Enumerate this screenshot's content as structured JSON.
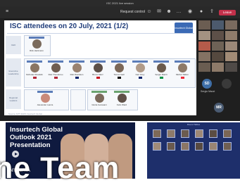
{
  "window": {
    "title": "ISC 2021 live session",
    "request_control_label": "Request control",
    "leave_label": "Leave"
  },
  "slide": {
    "title": "ISC attendees on 20 July, 2021 (1/2)",
    "logo_text": "Insurtech Global",
    "rows": [
      {
        "label": "CEO"
      },
      {
        "label": "Executive Leadership"
      },
      {
        "label": "Regional Leaders"
      }
    ],
    "people_row1": [
      "Rick Hartmann"
    ],
    "people_row2": [
      "Nicholas Shanklin",
      "Rob Theodorou",
      "Rob Davidson",
      "Bruno Merz",
      "Tomas Gall",
      "Karl Grey",
      "Sergio Mazzi",
      "Michel Tallion"
    ],
    "people_row3": [
      "Alexander Lanza"
    ],
    "people_row4": [
      "Gloria Goswami",
      "Felix Ward"
    ],
    "footer": "Source: NTT DATA Insurtech Global"
  },
  "sidebar": {
    "presenter_initials": "SD",
    "presenter_name": "Sergio Mazzi",
    "attendee_initials": "MR"
  },
  "thumb1": {
    "title": "Insurtech Global Outlook 2021 Presentation",
    "brand": "NTT DATA"
  },
  "thumb2": {
    "header": "Round Tables"
  },
  "overlay_text": "ne Team"
}
